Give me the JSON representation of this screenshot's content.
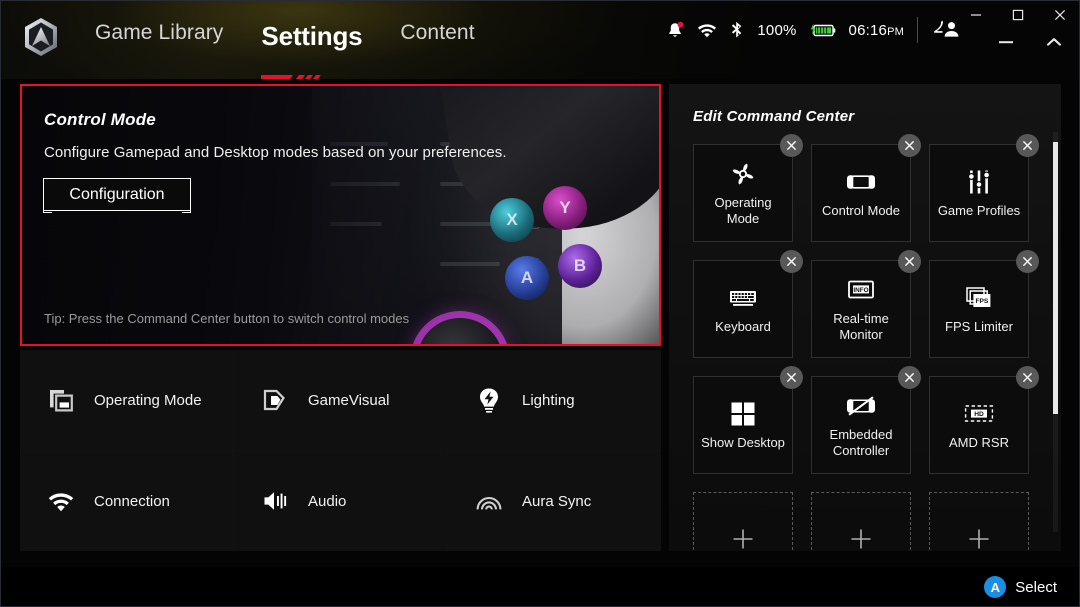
{
  "app": {
    "logo_icon": "rog-armoury-crate-hexagon-logo"
  },
  "nav": {
    "items": [
      {
        "label": "Game Library",
        "active": false
      },
      {
        "label": "Settings",
        "active": true
      },
      {
        "label": "Content",
        "active": false
      }
    ]
  },
  "status": {
    "notification_icon": "bell-icon",
    "wifi_icon": "wifi-icon",
    "bluetooth_icon": "bluetooth-icon",
    "battery_percent": "100%",
    "battery_icon": "battery-charging-icon",
    "battery_color": "#3ad13a",
    "time": "06:16",
    "time_ampm": "PM",
    "account_icon": "user-account-icon"
  },
  "window_controls": {
    "minimize": "minimize-icon",
    "maximize": "maximize-icon",
    "close": "close-icon",
    "app_minimize": "app-minimize-icon",
    "app_collapse": "app-collapse-chevron-icon"
  },
  "hero": {
    "title": "Control Mode",
    "description": "Configure Gamepad and Desktop modes based on your preferences.",
    "button_label": "Configuration",
    "tip": "Tip: Press the Command Center button to switch control modes",
    "selected_border_color": "#e8112d",
    "face_buttons": [
      {
        "label": "X",
        "color": "#2fb7c9"
      },
      {
        "label": "Y",
        "color": "#b8309e"
      },
      {
        "label": "A",
        "color": "#3a5fd0"
      },
      {
        "label": "B",
        "color": "#8e3bd4"
      }
    ]
  },
  "settings_tiles": [
    {
      "label": "Operating Mode",
      "icon": "operating-mode-icon"
    },
    {
      "label": "GameVisual",
      "icon": "gamevisual-icon"
    },
    {
      "label": "Lighting",
      "icon": "lighting-bulb-icon"
    },
    {
      "label": "Connection",
      "icon": "wifi-icon"
    },
    {
      "label": "Audio",
      "icon": "audio-speaker-icon"
    },
    {
      "label": "Aura Sync",
      "icon": "aura-sync-icon"
    }
  ],
  "command_center": {
    "title": "Edit Command Center",
    "close_icon": "close-icon",
    "add_icon": "plus-icon",
    "tiles": [
      {
        "label": "Operating Mode",
        "icon": "fan-icon",
        "removable": true
      },
      {
        "label": "Control Mode",
        "icon": "handheld-gamepad-icon",
        "removable": true
      },
      {
        "label": "Game Profiles",
        "icon": "sliders-icon",
        "removable": true
      },
      {
        "label": "Keyboard",
        "icon": "keyboard-icon",
        "removable": true
      },
      {
        "label": "Real-time Monitor",
        "icon": "info-monitor-icon",
        "removable": true
      },
      {
        "label": "FPS Limiter",
        "icon": "fps-stack-icon",
        "removable": true
      },
      {
        "label": "Show Desktop",
        "icon": "windows-squares-icon",
        "removable": true
      },
      {
        "label": "Embedded Controller",
        "icon": "gamepad-disabled-icon",
        "removable": true
      },
      {
        "label": "AMD RSR",
        "icon": "hd-dashed-icon",
        "removable": true
      }
    ],
    "add_slots": 3
  },
  "footer": {
    "button_glyph": "A",
    "button_color": "#1a8fe3",
    "action_label": "Select"
  }
}
